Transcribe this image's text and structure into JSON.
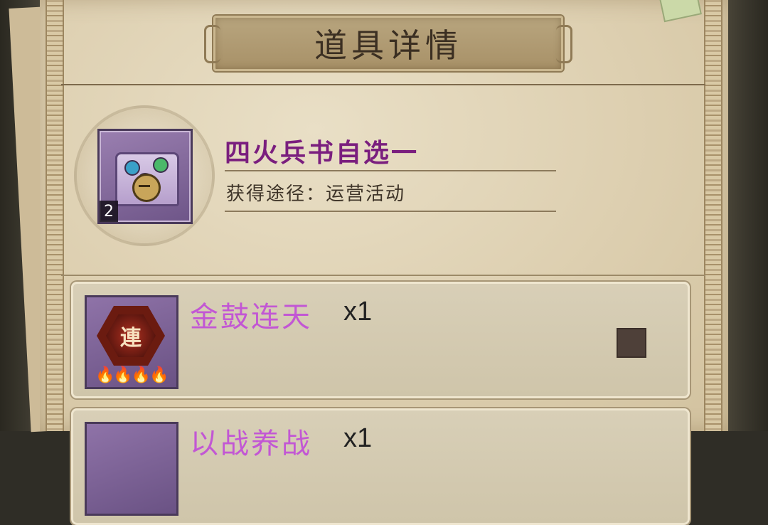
{
  "title": "道具详情",
  "item": {
    "name": "四火兵书自选一",
    "count": "2",
    "source_label": "获得途径：运营活动",
    "icon": "treasure-chest-icon"
  },
  "rewards": [
    {
      "name": "金鼓连天",
      "qty": "x1",
      "emblem_char": "連",
      "flames": "🔥🔥🔥🔥",
      "selected": false
    },
    {
      "name": "以战养战",
      "qty": "x1",
      "selected": false
    }
  ],
  "colors": {
    "item_name": "#7a1e7e",
    "reward_name": "#c257d4"
  }
}
